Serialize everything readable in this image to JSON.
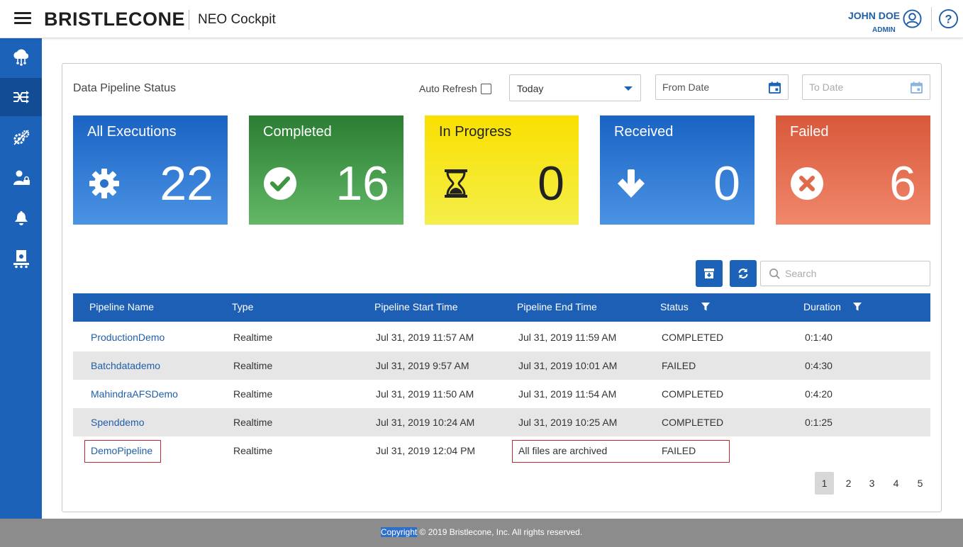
{
  "header": {
    "brand": "BRISTLECONE",
    "app_name": "NEO Cockpit",
    "user_name": "JOHN DOE",
    "user_role": "ADMIN",
    "icons": [
      "menu-icon",
      "user-circle-icon",
      "help-icon"
    ]
  },
  "sidebar": {
    "items": [
      {
        "icon": "cloud-network-icon",
        "active": false
      },
      {
        "icon": "pipeline-icon",
        "active": true
      },
      {
        "icon": "gears-icon",
        "active": false
      },
      {
        "icon": "user-lock-icon",
        "active": false
      },
      {
        "icon": "bell-icon",
        "active": false
      },
      {
        "icon": "conveyor-icon",
        "active": false
      }
    ]
  },
  "panel": {
    "title": "Data Pipeline Status",
    "auto_refresh_label": "Auto Refresh",
    "auto_refresh_checked": false,
    "range_select": "Today",
    "from_date_placeholder": "From Date",
    "to_date_placeholder": "To Date"
  },
  "cards": {
    "all": {
      "label": "All Executions",
      "count": "22"
    },
    "completed": {
      "label": "Completed",
      "count": "16"
    },
    "progress": {
      "label": "In Progress",
      "count": "0"
    },
    "received": {
      "label": "Received",
      "count": "0"
    },
    "failed": {
      "label": "Failed",
      "count": "6"
    }
  },
  "search": {
    "placeholder": "Search"
  },
  "table": {
    "columns": {
      "name": "Pipeline Name",
      "type": "Type",
      "start": "Pipeline Start Time",
      "end": "Pipeline End Time",
      "status": "Status",
      "duration": "Duration"
    },
    "rows": [
      {
        "name": "ProductionDemo",
        "type": "Realtime",
        "start": "Jul 31, 2019 11:57 AM",
        "end": "Jul 31, 2019 11:59 AM",
        "status": "COMPLETED",
        "duration": "0:1:40"
      },
      {
        "name": "Batchdatademo",
        "type": "Realtime",
        "start": "Jul 31, 2019 9:57 AM",
        "end": "Jul 31, 2019 10:01 AM",
        "status": "FAILED",
        "duration": "0:4:30"
      },
      {
        "name": "MahindraAFSDemo",
        "type": "Realtime",
        "start": "Jul 31, 2019 11:50 AM",
        "end": "Jul 31, 2019 11:54 AM",
        "status": "COMPLETED",
        "duration": "0:4:20"
      },
      {
        "name": "Spenddemo",
        "type": "Realtime",
        "start": "Jul 31, 2019 10:24 AM",
        "end": "Jul 31, 2019 10:25 AM",
        "status": "COMPLETED",
        "duration": "0:1:25"
      },
      {
        "name": "DemoPipeline",
        "type": "Realtime",
        "start": "Jul 31, 2019 12:04 PM",
        "end": "All files are archived",
        "status": "FAILED",
        "duration": ""
      }
    ]
  },
  "pagination": {
    "pages": [
      "1",
      "2",
      "3",
      "4",
      "5"
    ],
    "current": "1"
  },
  "footer": {
    "highlight": "Copyright",
    "text": " © 2019 Bristlecone, Inc. All rights reserved."
  }
}
